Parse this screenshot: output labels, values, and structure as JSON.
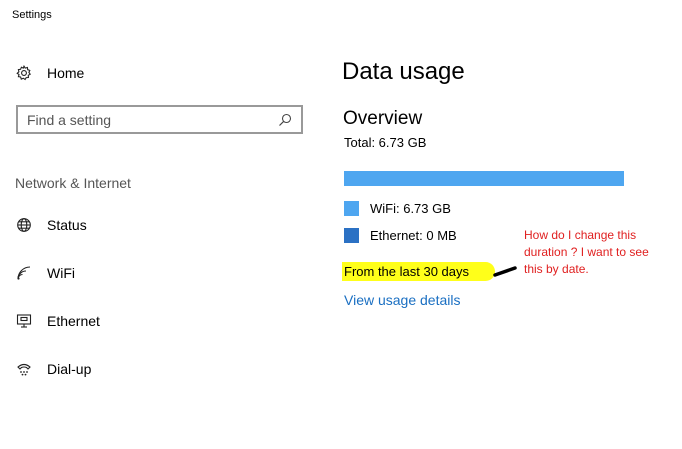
{
  "window": {
    "title": "Settings"
  },
  "sidebar": {
    "home_label": "Home",
    "search_placeholder": "Find a setting",
    "section_title": "Network & Internet",
    "items": [
      {
        "label": "Status",
        "icon": "globe-icon"
      },
      {
        "label": "WiFi",
        "icon": "wifi-icon"
      },
      {
        "label": "Ethernet",
        "icon": "ethernet-icon"
      },
      {
        "label": "Dial-up",
        "icon": "dialup-icon"
      }
    ]
  },
  "main": {
    "title": "Data usage",
    "overview_heading": "Overview",
    "total": "Total: 6.73 GB",
    "usage_bar": {
      "wifi_fraction": 1.0,
      "ethernet_fraction": 0.0
    },
    "legend": [
      {
        "label": "WiFi: 6.73 GB",
        "color": "#4ea6f0"
      },
      {
        "label": "Ethernet: 0 MB",
        "color": "#2b71c4"
      }
    ],
    "period": "From the last 30 days",
    "view_details_link": "View usage details",
    "annotation": "How do I change this duration ? I want to see this by date."
  },
  "colors": {
    "accent_link": "#1a6fc2",
    "highlight": "#ffff1a",
    "annotation_text": "#e02020"
  }
}
